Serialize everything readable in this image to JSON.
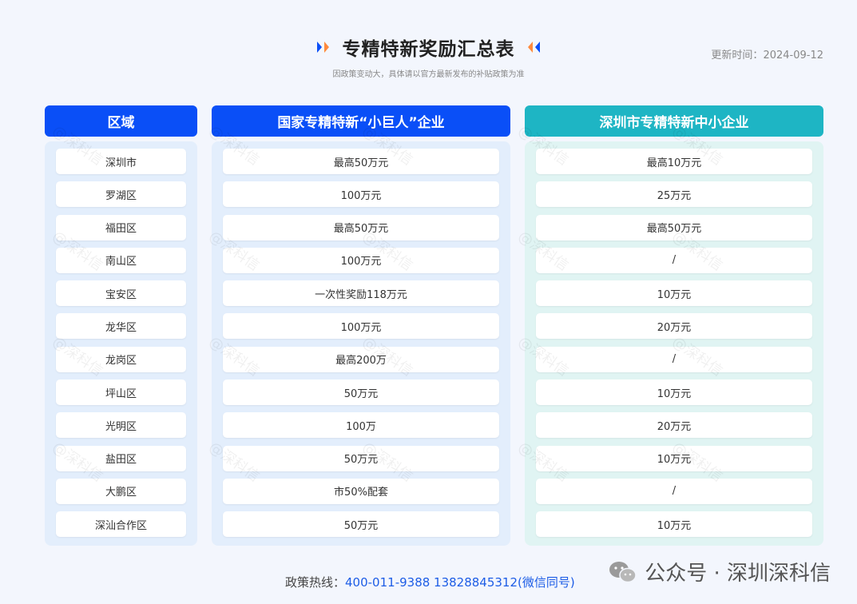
{
  "header": {
    "title": "专精特新奖励汇总表",
    "subtitle": "因政策变动大，具体请以官方最新发布的补贴政策为准",
    "update_label": "更新时间：",
    "update_date": "2024-09-12"
  },
  "table": {
    "columns": [
      "区域",
      "国家专精特新“小巨人”企业",
      "深圳市专精特新中小企业"
    ],
    "rows": [
      [
        "深圳市",
        "最高50万元",
        "最高10万元"
      ],
      [
        "罗湖区",
        "100万元",
        "25万元"
      ],
      [
        "福田区",
        "最高50万元",
        "最高50万元"
      ],
      [
        "南山区",
        "100万元",
        "/"
      ],
      [
        "宝安区",
        "一次性奖励118万元",
        "10万元"
      ],
      [
        "龙华区",
        "100万元",
        "20万元"
      ],
      [
        "龙岗区",
        "最高200万",
        "/"
      ],
      [
        "坪山区",
        "50万元",
        "10万元"
      ],
      [
        "光明区",
        "100万",
        "20万元"
      ],
      [
        "盐田区",
        "50万元",
        "10万元"
      ],
      [
        "大鹏区",
        "市50%配套",
        "/"
      ],
      [
        "深汕合作区",
        "50万元",
        "10万元"
      ]
    ]
  },
  "watermark": "@深科信",
  "footer": {
    "label": "政策热线：",
    "hotline": "400-011-9388 13828845312(微信同号)"
  },
  "brand": {
    "text": "公众号 · 深圳深科信",
    "icon": "wechat-icon"
  },
  "colors": {
    "primary_blue": "#0a4ff7",
    "teal": "#1eb5c4",
    "hotline_blue": "#1d5de6",
    "deco_orange": "#ff8a3d"
  }
}
